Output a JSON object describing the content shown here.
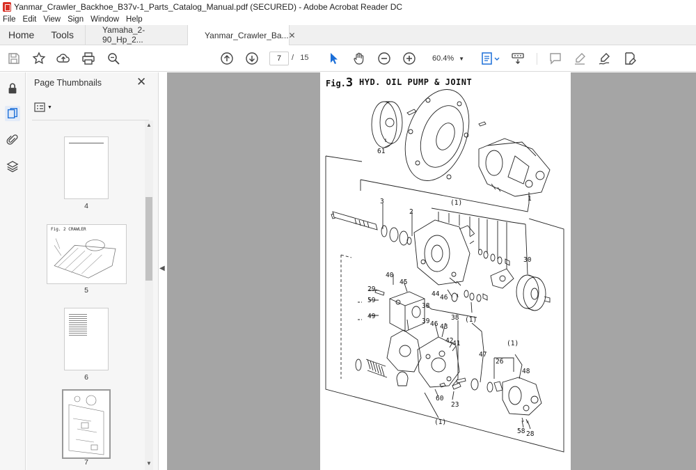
{
  "window": {
    "title": "Yanmar_Crawler_Backhoe_B37v-1_Parts_Catalog_Manual.pdf (SECURED) - Adobe Acrobat Reader DC"
  },
  "menu": [
    "File",
    "Edit",
    "View",
    "Sign",
    "Window",
    "Help"
  ],
  "tabs": {
    "home": "Home",
    "tools": "Tools",
    "docs": [
      {
        "label": "Yamaha_2-90_Hp_2...",
        "active": false
      },
      {
        "label": "Yanmar_Crawler_Ba...",
        "active": true
      }
    ]
  },
  "toolbar": {
    "current_page": "7",
    "page_separator": "/",
    "total_pages": "15",
    "zoom": "60.4%",
    "icons": [
      "save-icon",
      "bookmark-star-icon",
      "upload-cloud-icon",
      "print-icon",
      "find-zoom-icon",
      "prev-page-icon",
      "next-page-icon",
      "select-cursor-icon",
      "hand-icon",
      "zoom-out-icon",
      "zoom-in-icon",
      "fit-page-icon",
      "keyboard-scroll-icon",
      "comment-icon",
      "highlight-icon",
      "sign-icon",
      "fill-sign-icon"
    ]
  },
  "rail": {
    "icons": [
      "lock-icon",
      "page-thumbnails-icon",
      "attachments-icon",
      "layers-icon"
    ]
  },
  "thumbnails": {
    "header": "Page Thumbnails",
    "pages": [
      {
        "num": "4"
      },
      {
        "num": "5",
        "caption": "Fig. 2  CRAWLER"
      },
      {
        "num": "6"
      },
      {
        "num": "7"
      }
    ]
  },
  "document": {
    "fig_prefix": "Fig.",
    "fig_number": "3",
    "heading": "HYD. OIL PUMP & JOINT",
    "callouts": [
      "61",
      "1",
      "(1)",
      "3",
      "2",
      "30",
      "40",
      "45",
      "29",
      "59",
      "44",
      "46",
      "38",
      "49",
      "(1)",
      "38",
      "39",
      "46",
      "43",
      "42",
      "41",
      "(1)",
      "47",
      "26",
      "48",
      "60",
      "23",
      "(1)",
      "58",
      "28"
    ]
  }
}
